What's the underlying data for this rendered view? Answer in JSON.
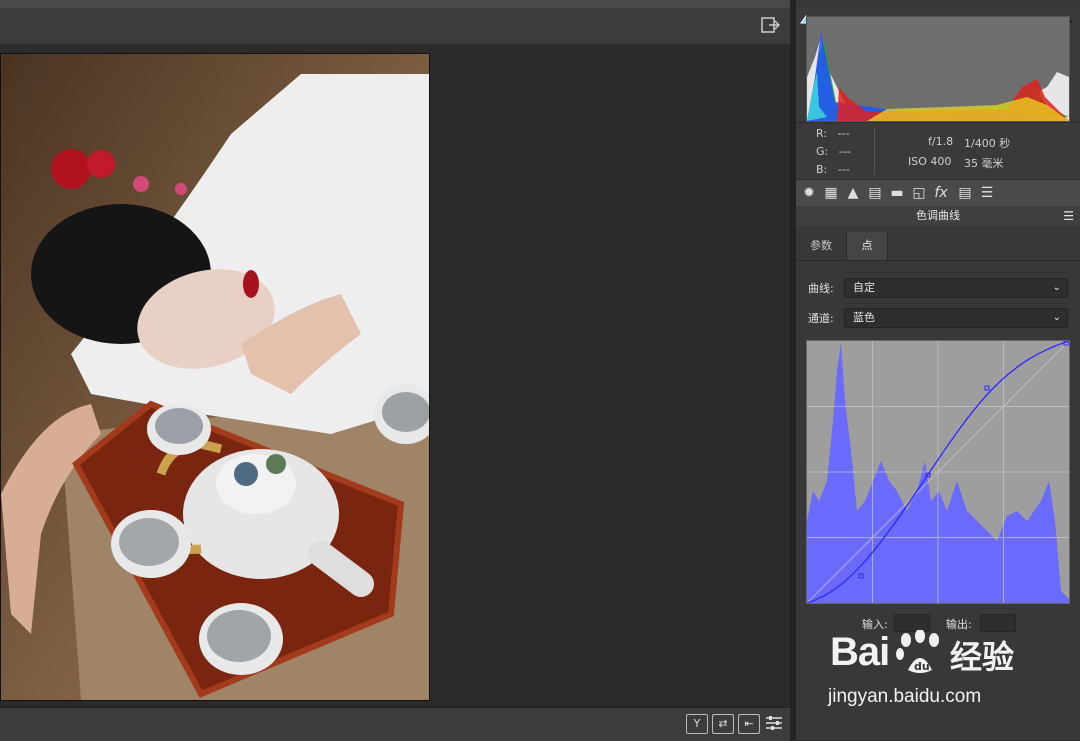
{
  "readout": {
    "r_label": "R:",
    "r_value": "---",
    "g_label": "G:",
    "g_value": "---",
    "b_label": "B:",
    "b_value": "---",
    "aperture": "f/1.8",
    "shutter": "1/400 秒",
    "iso": "ISO 400",
    "focal": "35 毫米"
  },
  "panel": {
    "section_title": "色调曲线",
    "tabs": [
      {
        "label": "参数",
        "active": false
      },
      {
        "label": "点",
        "active": true
      }
    ],
    "curve_label": "曲线:",
    "curve_value": "自定",
    "channel_label": "通道:",
    "channel_value": "蓝色",
    "input_label": "输入:",
    "output_label": "输出:"
  },
  "tool_icons": [
    "aperture-icon",
    "grid-icon",
    "mountains-icon",
    "split-panel-icon",
    "detail-icon",
    "lens-icon",
    "fx-icon",
    "film-icon",
    "sliders-icon"
  ],
  "bottom_buttons": [
    "Y",
    "⇄",
    "⇤",
    "sliders-icon"
  ],
  "watermark": {
    "brand_text": "Bai",
    "brand_suffix": "经验",
    "url": "jingyan.baidu.com"
  },
  "colors": {
    "curve_line": "#3a3aff",
    "histogram_blue": "#6a6afc",
    "panel_bg": "#383838"
  }
}
